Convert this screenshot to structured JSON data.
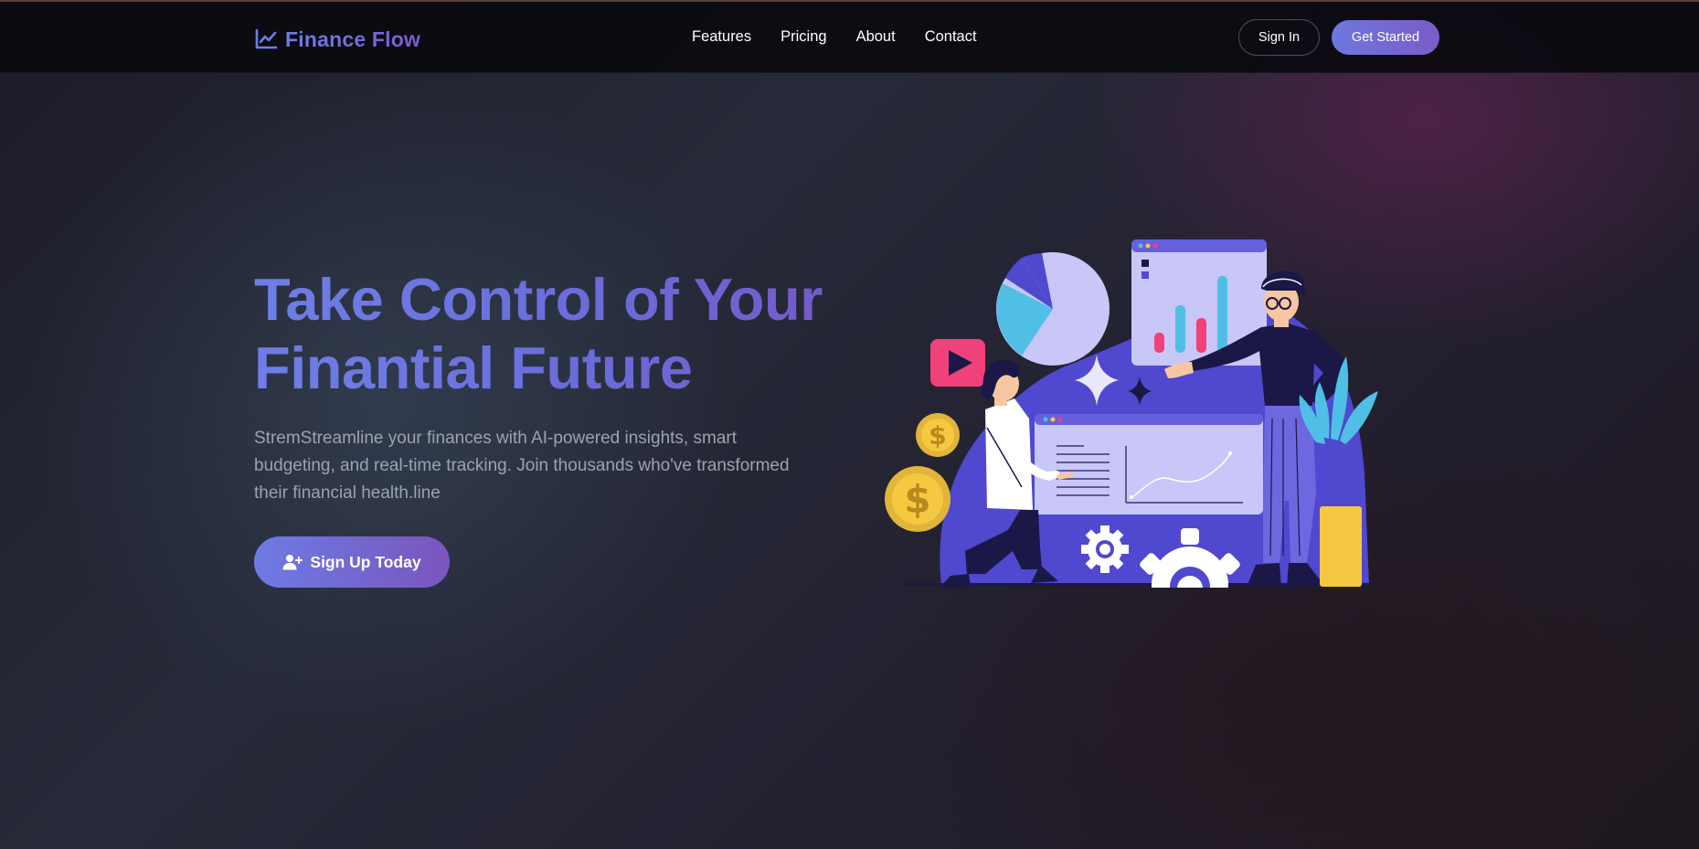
{
  "brand": {
    "name": "Finance Flow",
    "icon": "chart-line-icon"
  },
  "nav": {
    "links": [
      {
        "label": "Features"
      },
      {
        "label": "Pricing"
      },
      {
        "label": "About"
      },
      {
        "label": "Contact"
      }
    ],
    "sign_in": "Sign In",
    "get_started": "Get Started"
  },
  "hero": {
    "title_line1": "Take Control of Your",
    "title_line2": "Finantial Future",
    "subtitle": "StremStreamline your finances with AI-powered insights, smart budgeting, and real-time tracking. Join thousands who've transformed their financial health.line",
    "cta_label": "Sign Up Today",
    "cta_icon": "user-plus-icon"
  },
  "illustration": {
    "name": "finance-team-illustration",
    "icons": [
      "play-icon",
      "dollar-coin-icon",
      "gear-icon",
      "pie-chart",
      "bar-chart",
      "line-chart",
      "sparkle-icon",
      "plant"
    ]
  },
  "colors": {
    "accent": "#6f7de6",
    "accent_purple": "#7b5bc9",
    "illustration_blue": "#5a52d5",
    "subtitle_gray": "#9ca3af"
  }
}
